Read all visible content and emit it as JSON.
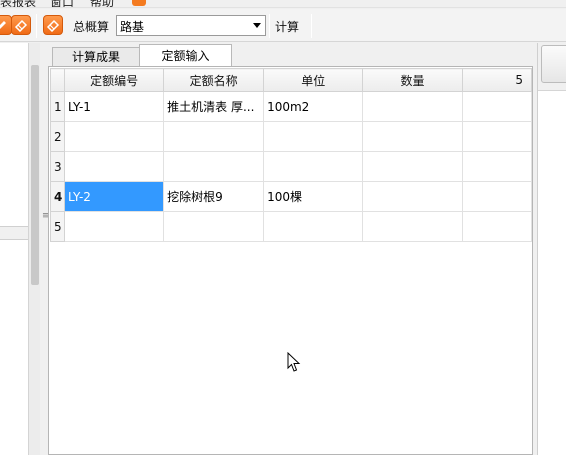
{
  "menubar": {
    "items": [
      "表报表",
      "窗口",
      "帮助"
    ]
  },
  "toolbar": {
    "total_estimate_label": "总概算",
    "select_value": "路基",
    "calc_label": "计算"
  },
  "tabs": [
    {
      "label": "计算成果",
      "active": false
    },
    {
      "label": "定额输入",
      "active": true
    }
  ],
  "grid": {
    "headers": [
      "定额编号",
      "定额名称",
      "单位",
      "数量",
      "5"
    ],
    "rows": [
      {
        "num": "1",
        "code": "LY-1",
        "name": "推土机清表 厚...",
        "unit": "100m2",
        "qty": "",
        "extra": ""
      },
      {
        "num": "2",
        "code": "",
        "name": "",
        "unit": "",
        "qty": "",
        "extra": ""
      },
      {
        "num": "3",
        "code": "",
        "name": "",
        "unit": "",
        "qty": "",
        "extra": ""
      },
      {
        "num": "4",
        "code": "LY-2",
        "name": "挖除树根9",
        "unit": "100棵",
        "qty": "",
        "extra": ""
      },
      {
        "num": "5",
        "code": "",
        "name": "",
        "unit": "",
        "qty": "",
        "extra": ""
      }
    ],
    "selected_row": 3
  },
  "colors": {
    "selection": "#3399ff",
    "toolbar_icon": "#f06b16"
  }
}
